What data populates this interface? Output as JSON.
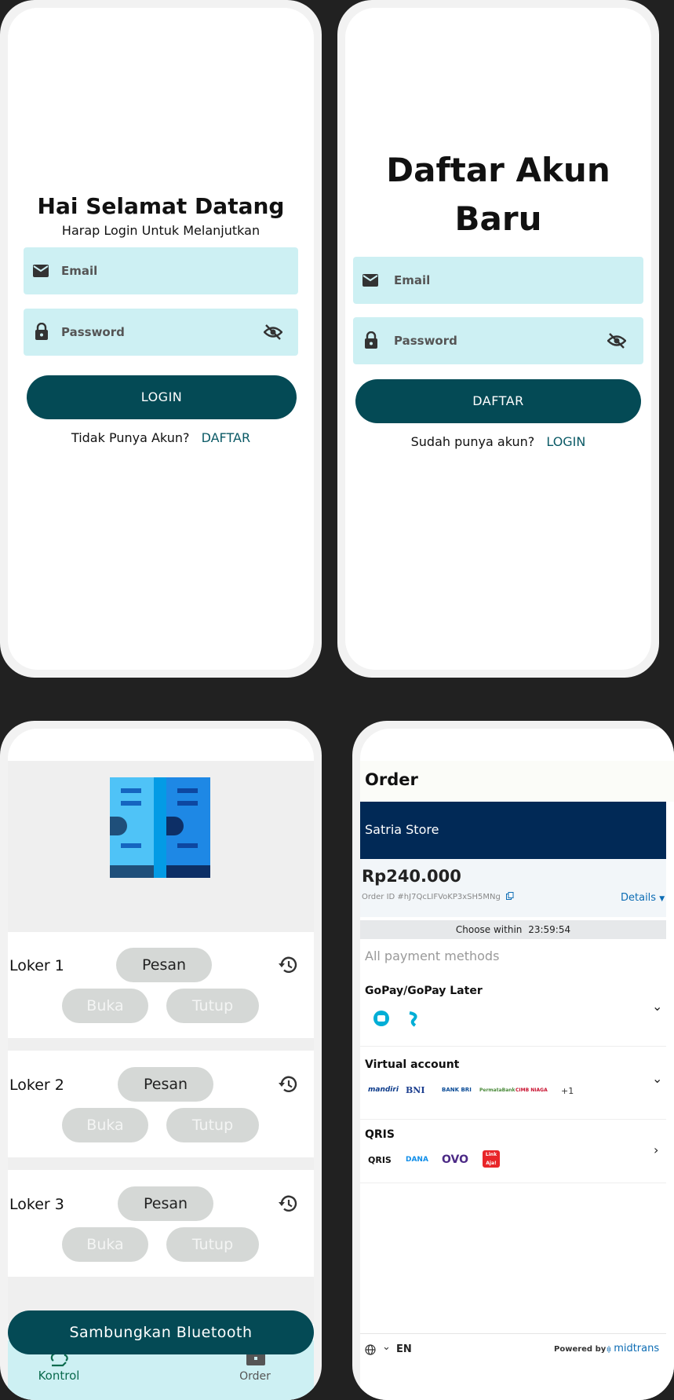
{
  "login": {
    "title": "Hai Selamat Datang",
    "subtitle": "Harap Login Untuk Melanjutkan",
    "email_placeholder": "Email",
    "password_placeholder": "Password",
    "login_button": "LOGIN",
    "no_account_text": "Tidak Punya Akun?",
    "register_link": "DAFTAR"
  },
  "register": {
    "title_line1": "Daftar Akun",
    "title_line2": "Baru",
    "email_placeholder": "Email",
    "password_placeholder": "Password",
    "register_button": "DAFTAR",
    "have_account_text": "Sudah punya akun?",
    "login_link": "LOGIN"
  },
  "control": {
    "lockers": [
      {
        "name": "Loker 1",
        "order": "Pesan",
        "open": "Buka",
        "close": "Tutup"
      },
      {
        "name": "Loker 2",
        "order": "Pesan",
        "open": "Buka",
        "close": "Tutup"
      },
      {
        "name": "Loker 3",
        "order": "Pesan",
        "open": "Buka",
        "close": "Tutup"
      }
    ],
    "bluetooth_button": "Sambungkan Bluetooth",
    "nav": [
      {
        "label": "Kontrol",
        "icon": "cloud-hand-icon",
        "active": true
      },
      {
        "label": "Order",
        "icon": "briefcase-icon",
        "active": false
      }
    ]
  },
  "order": {
    "title": "Order",
    "store": "Satria Store",
    "amount": "Rp240.000",
    "order_id": "Order ID #hJ7QcLIFVoKP3xSH5MNg",
    "details": "Details",
    "choose_within": "Choose within",
    "timer": "23:59:54",
    "all_methods": "All payment methods",
    "methods": [
      {
        "name": "GoPay/GoPay Later"
      },
      {
        "name": "Virtual account",
        "more": "+1"
      },
      {
        "name": "QRIS"
      }
    ],
    "va_logos": [
      "mandiri",
      "BNI",
      "BANK BRI",
      "PermataBank",
      "CIMB NIAGA"
    ],
    "qris_logos": [
      "QRIS",
      "DANA",
      "OVO",
      "Link Aja!"
    ],
    "language": "EN",
    "powered_by": "Powered by",
    "brand": "midtrans",
    "colors": {
      "store_bar": "#012956",
      "link": "#0c6cb4"
    }
  }
}
